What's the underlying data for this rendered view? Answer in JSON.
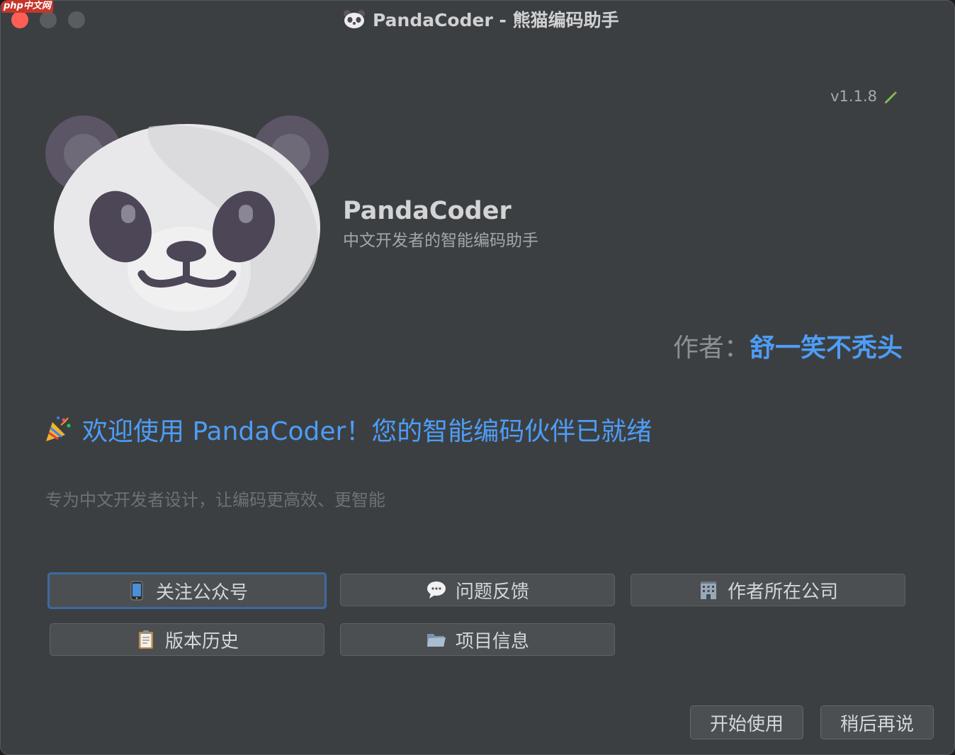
{
  "window": {
    "title": "PandaCoder - 熊猫编码助手",
    "watermark": "php中文网"
  },
  "header": {
    "version": "v1.1.8",
    "app_name": "PandaCoder",
    "tagline": "中文开发者的智能编码助手"
  },
  "author": {
    "label": "作者：",
    "name": "舒一笑不秃头"
  },
  "welcome": {
    "text": "欢迎使用 PandaCoder！您的智能编码伙伴已就绪",
    "subtitle": "专为中文开发者设计，让编码更高效、更智能"
  },
  "actions": [
    {
      "label": "关注公众号",
      "icon": "phone-icon",
      "focused": true
    },
    {
      "label": "问题反馈",
      "icon": "speech-bubble-icon"
    },
    {
      "label": "作者所在公司",
      "icon": "office-building-icon"
    },
    {
      "label": "版本历史",
      "icon": "clipboard-icon"
    },
    {
      "label": "项目信息",
      "icon": "folder-icon"
    }
  ],
  "footer": {
    "start_label": "开始使用",
    "later_label": "稍后再说"
  },
  "colors": {
    "background": "#3c3f41",
    "accent": "#4d9df6",
    "close": "#ff5f57"
  }
}
